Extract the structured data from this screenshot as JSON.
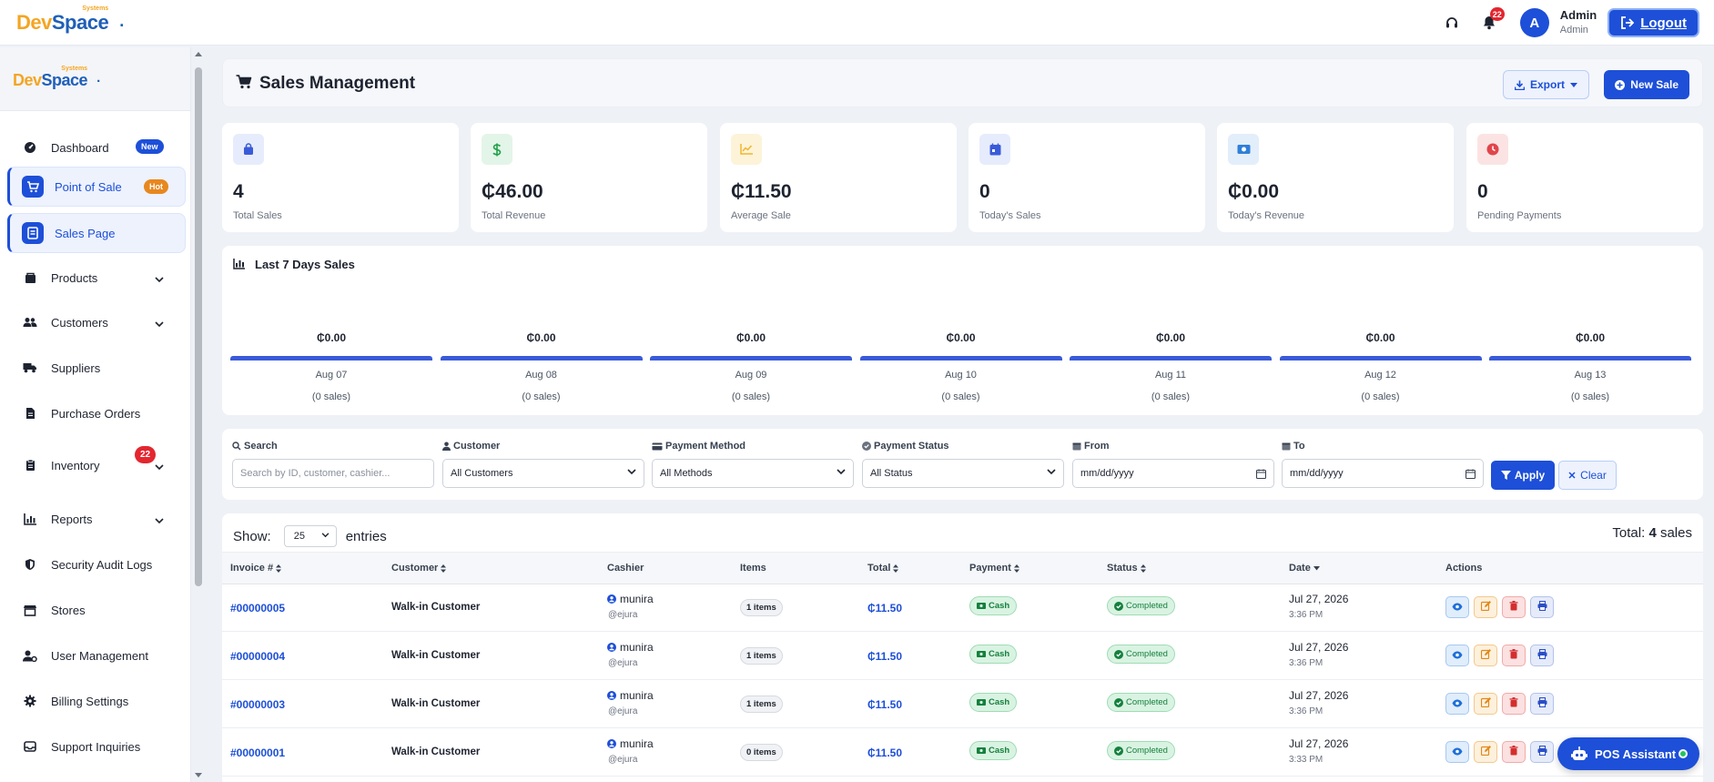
{
  "brand": {
    "dev": "Dev",
    "space": "Space",
    "systems": "Systems",
    "dot": "."
  },
  "topbar": {
    "notifications": "22",
    "avatar": "A",
    "user_name": "Admin",
    "user_role": "Admin",
    "logout": "Logout"
  },
  "sidebar": {
    "items": [
      {
        "label": "Dashboard",
        "badge": "New"
      },
      {
        "label": "Point of Sale",
        "badge": "Hot"
      },
      {
        "label": "Sales Page"
      },
      {
        "label": "Products"
      },
      {
        "label": "Customers"
      },
      {
        "label": "Suppliers"
      },
      {
        "label": "Purchase Orders"
      },
      {
        "label": "Inventory",
        "badge": "22"
      },
      {
        "label": "Reports"
      },
      {
        "label": "Security Audit Logs"
      },
      {
        "label": "Stores"
      },
      {
        "label": "User Management"
      },
      {
        "label": "Billing Settings"
      },
      {
        "label": "Support Inquiries"
      }
    ]
  },
  "header": {
    "title": "Sales Management",
    "export": "Export",
    "new_sale": "New Sale"
  },
  "stats": [
    {
      "value": "4",
      "label": "Total Sales",
      "color": "#e6ecfb",
      "icon": "shopping-bag-icon"
    },
    {
      "value": "₵46.00",
      "label": "Total Revenue",
      "color": "#e3f5e8",
      "icon": "dollar-icon"
    },
    {
      "value": "₵11.50",
      "label": "Average Sale",
      "color": "#fdf3d9",
      "icon": "line-chart-icon"
    },
    {
      "value": "0",
      "label": "Today's Sales",
      "color": "#e6ecfb",
      "icon": "calendar-icon"
    },
    {
      "value": "₵0.00",
      "label": "Today's Revenue",
      "color": "#e3eefb",
      "icon": "cash-icon"
    },
    {
      "value": "0",
      "label": "Pending Payments",
      "color": "#fbe3e3",
      "icon": "clock-icon"
    }
  ],
  "chart_data": {
    "type": "bar",
    "title": "Last 7 Days Sales",
    "categories": [
      "Aug 07",
      "Aug 08",
      "Aug 09",
      "Aug 10",
      "Aug 11",
      "Aug 12",
      "Aug 13"
    ],
    "values": [
      0,
      0,
      0,
      0,
      0,
      0,
      0
    ],
    "value_labels": [
      "₵0.00",
      "₵0.00",
      "₵0.00",
      "₵0.00",
      "₵0.00",
      "₵0.00",
      "₵0.00"
    ],
    "count_labels": [
      "(0 sales)",
      "(0 sales)",
      "(0 sales)",
      "(0 sales)",
      "(0 sales)",
      "(0 sales)",
      "(0 sales)"
    ]
  },
  "filters": {
    "search_label": "Search",
    "search_placeholder": "Search by ID, customer, cashier...",
    "customer_label": "Customer",
    "customer_value": "All Customers",
    "method_label": "Payment Method",
    "method_value": "All Methods",
    "status_label": "Payment Status",
    "status_value": "All Status",
    "from_label": "From",
    "from_value": "mm/dd/yyyy",
    "to_label": "To",
    "to_value": "mm/dd/yyyy",
    "apply": "Apply",
    "clear": "Clear"
  },
  "table": {
    "show": "Show:",
    "entries_value": "25",
    "entries": "entries",
    "total_prefix": "Total:",
    "total_count": "4",
    "total_suffix": "sales",
    "columns": [
      "Invoice #",
      "Customer",
      "Cashier",
      "Items",
      "Total",
      "Payment",
      "Status",
      "Date",
      "Actions"
    ],
    "rows": [
      {
        "invoice": "#00000005",
        "customer": "Walk-in Customer",
        "cashier": "munira",
        "username": "@ejura",
        "items": "1 items",
        "total": "₵11.50",
        "payment": "Cash",
        "status": "Completed",
        "date": "Jul 27, 2026",
        "time": "3:36 PM"
      },
      {
        "invoice": "#00000004",
        "customer": "Walk-in Customer",
        "cashier": "munira",
        "username": "@ejura",
        "items": "1 items",
        "total": "₵11.50",
        "payment": "Cash",
        "status": "Completed",
        "date": "Jul 27, 2026",
        "time": "3:36 PM"
      },
      {
        "invoice": "#00000003",
        "customer": "Walk-in Customer",
        "cashier": "munira",
        "username": "@ejura",
        "items": "1 items",
        "total": "₵11.50",
        "payment": "Cash",
        "status": "Completed",
        "date": "Jul 27, 2026",
        "time": "3:36 PM"
      },
      {
        "invoice": "#00000001",
        "customer": "Walk-in Customer",
        "cashier": "munira",
        "username": "@ejura",
        "items": "0 items",
        "total": "₵11.50",
        "payment": "Cash",
        "status": "Completed",
        "date": "Jul 27, 2026",
        "time": "3:33 PM"
      }
    ]
  },
  "assistant": {
    "label": "POS Assistant"
  }
}
